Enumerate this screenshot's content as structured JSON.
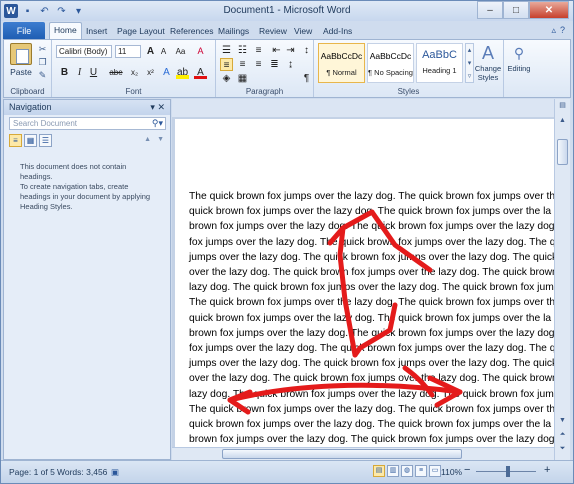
{
  "window": {
    "title": "Document1 - Microsoft Word"
  },
  "tabs": {
    "file": "File",
    "items": [
      "Home",
      "Insert",
      "Page Layout",
      "References",
      "Mailings",
      "Review",
      "View",
      "Add-Ins"
    ]
  },
  "ribbon": {
    "clipboard": {
      "paste": "Paste",
      "label": "Clipboard"
    },
    "font": {
      "name": "Calibri (Body)",
      "size": "11",
      "label": "Font",
      "bold": "B",
      "italic": "I",
      "underline": "U",
      "strike": "abe",
      "subscript": "x₂",
      "superscript": "x²",
      "grow": "A",
      "shrink": "A",
      "case": "Aa",
      "clear": "A"
    },
    "paragraph": {
      "label": "Paragraph",
      "pilcrow": "¶"
    },
    "styles": {
      "label": "Styles",
      "items": [
        {
          "sample": "AaBbCcDc",
          "name": "¶ Normal"
        },
        {
          "sample": "AaBbCcDc",
          "name": "¶ No Spacing"
        },
        {
          "sample": "AaBbC",
          "name": "Heading 1"
        }
      ],
      "change_styles": "Change Styles"
    },
    "editing": {
      "label": "Editing"
    }
  },
  "navigation": {
    "title": "Navigation",
    "search_placeholder": "Search Document",
    "msg1": "This document does not contain headings.",
    "msg2": "To create navigation tabs, create headings in your document by applying Heading Styles."
  },
  "document": {
    "lines": [
      "The quick brown fox jumps over the lazy dog. The quick brown fox jumps over th",
      "quick brown fox jumps over the lazy dog. The quick brown fox jumps over the la",
      "brown fox jumps over the lazy dog. The quick brown fox jumps over the lazy dog",
      "fox jumps over the lazy dog. The quick brown fox jumps over the lazy dog. The q",
      "jumps over the lazy dog. The quick brown fox jumps over the lazy dog. The quick",
      "over the lazy dog. The quick brown fox jumps over the lazy dog. The quick brown",
      "lazy dog. The quick brown fox jumps over the lazy dog. The quick brown fox jum",
      "The quick brown fox jumps over the lazy dog. The quick brown fox jumps over the",
      "quick brown fox jumps over the lazy dog. The quick brown fox jumps over the la",
      "brown fox jumps over the lazy dog. The quick brown fox jumps over the lazy dog",
      "fox jumps over the lazy dog. The quick brown fox jumps over the lazy dog. The q",
      "jumps over the lazy dog. The quick brown fox jumps over the lazy dog. The quick",
      "over the lazy dog. The quick brown fox jumps over the lazy dog. The quick brown",
      "lazy dog. The quick brown fox jumps over the lazy dog. The quick brown fox jum",
      "The quick brown fox jumps over the lazy dog. The quick brown fox jumps over the",
      "quick brown fox jumps over the lazy dog. The quick brown fox jumps over the la",
      "brown fox jumps over the lazy dog. The quick brown fox jumps over the lazy dog"
    ]
  },
  "status": {
    "page": "Page: 1 of 5",
    "words": "Words: 3,456",
    "zoom": "110%",
    "zoom_minus": "−",
    "zoom_plus": "+"
  },
  "annotation_color": "#e41b1b"
}
